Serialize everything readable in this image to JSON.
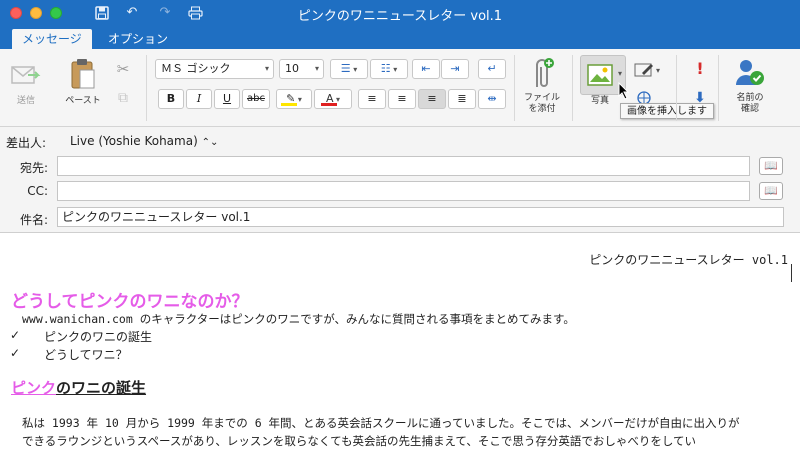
{
  "window": {
    "title": "ピンクのワニニュースレター vol.1"
  },
  "tabs": [
    {
      "label": "メッセージ"
    },
    {
      "label": "オプション"
    }
  ],
  "ribbon": {
    "send_label": "送信",
    "paste_label": "ペースト",
    "font_name": "ＭＳ ゴシック",
    "font_size": "10",
    "attach_label_1": "ファイル",
    "attach_label_2": "を添付",
    "photo_label": "写真",
    "tooltip": "画像を挿入します",
    "names_label_1": "名前の",
    "names_label_2": "確認",
    "bold": "B",
    "italic": "I",
    "underline": "U",
    "strike": "abc"
  },
  "header": {
    "from_label": "差出人:",
    "from_value": "Live (Yoshie Kohama)",
    "to_label": "宛先:",
    "cc_label": "CC:",
    "subject_label": "件名:",
    "subject_value": "ピンクのワニニュースレター vol.1"
  },
  "body": {
    "header_line": "ピンクのワニニュースレター vol.1",
    "heading1": "どうしてピンクのワニなのか？",
    "intro": "www.wanichan.com のキャラクターはピンクのワニですが、みんなに質問される事項をまとめてみます。",
    "checks": [
      {
        "mark": "✓",
        "text": "ピンクのワニの誕生"
      },
      {
        "mark": "✓",
        "text": "どうしてワニ？"
      }
    ],
    "heading2_pink": "ピンク",
    "heading2_rest": "のワニの誕生",
    "para_line1": "私は 1993 年 10 月から 1999 年までの 6 年間、とある英会話スクールに通っていました。そこでは、メンバーだけが自由に出入りが",
    "para_line2": "できるラウンジというスペースがあり、レッスンを取らなくても英会話の先生捕まえて、そこで思う存分英語でおしゃべりをしてい"
  },
  "colors": {
    "accent": "#1f6fc2",
    "pink": "#e55ce8"
  }
}
